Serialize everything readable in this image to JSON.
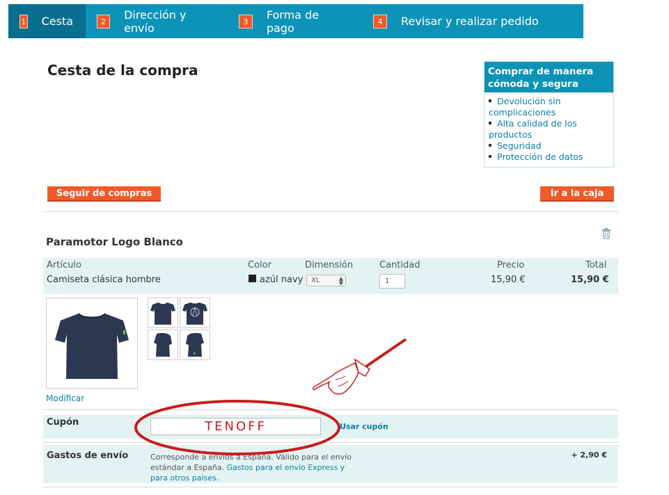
{
  "steps": [
    {
      "num": "1",
      "label": "Cesta"
    },
    {
      "num": "2",
      "label": "Dirección y envío"
    },
    {
      "num": "3",
      "label": "Forma de pago"
    },
    {
      "num": "4",
      "label": "Revisar y realizar pedido"
    }
  ],
  "page_title": "Cesta de la compra",
  "trust_box": {
    "title": "Comprar de manera cómoda y segura",
    "items": [
      "Devolución sin complicaciones",
      "Alta calidad de los productos",
      "Seguridad",
      "Protección de datos"
    ]
  },
  "buttons": {
    "continue_shopping": "Seguir de compras",
    "checkout": "Ir a la caja"
  },
  "product": {
    "title": "Paramotor Logo Blanco",
    "headers": {
      "article": "Artículo",
      "color": "Color",
      "size": "Dimensión",
      "quantity": "Cantidad",
      "price": "Precio",
      "total": "Total"
    },
    "article": "Camiseta clásica hombre",
    "color": "azúl navy",
    "size": "XL",
    "quantity": "1",
    "price": "15,90 €",
    "total": "15,90 €",
    "modify_link": "Modificar",
    "icons": {
      "delete": "trash-icon"
    },
    "colors": {
      "shirt": "#2b3850"
    }
  },
  "coupon": {
    "label": "Cupón",
    "value": "TENOFF",
    "button": "Usar cupón"
  },
  "shipping": {
    "label": "Gastos de envío",
    "text": "Corresponde a envíos a España. Válido para el envío estándar a España. ",
    "link": "Gastos para el envío Express y para otros países.",
    "price": "+ 2,90 €"
  },
  "colors": {
    "brand_blue": "#0d93b8",
    "active_step": "#0a6f8f",
    "accent_orange": "#ef5a29",
    "band": "#e3f3f2",
    "annotation_red": "#c81c1c"
  }
}
